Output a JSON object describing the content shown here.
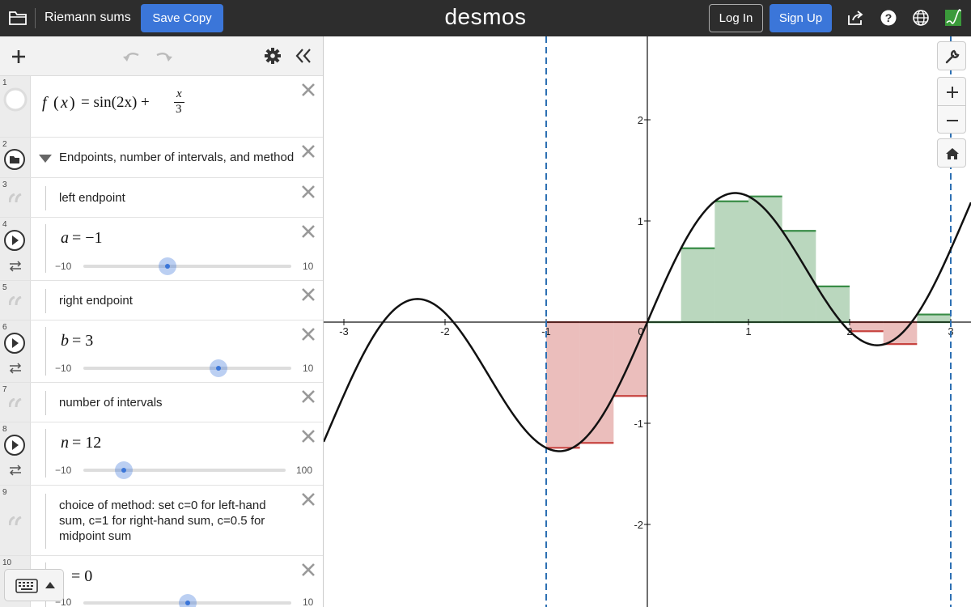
{
  "header": {
    "title": "Riemann sums",
    "save_copy": "Save Copy",
    "logo": "desmos",
    "login": "Log In",
    "signup": "Sign Up",
    "icons": [
      "folder-icon",
      "share-icon",
      "help-icon",
      "globe-icon",
      "account-icon"
    ]
  },
  "toolbar": {
    "icons": [
      "add-icon",
      "undo-icon",
      "redo-icon",
      "gear-icon",
      "collapse-icon"
    ]
  },
  "expressions": {
    "e1": {
      "index": "1",
      "fname": "f",
      "xvar": "x",
      "eq": "= sin(2x) +",
      "num": "x",
      "den": "3"
    },
    "e2": {
      "index": "2",
      "label": "Endpoints, number of intervals, and method"
    },
    "e3": {
      "index": "3",
      "label": "left endpoint"
    },
    "e4": {
      "index": "4",
      "var": "a",
      "value": "= −1",
      "min": "−10",
      "max": "10"
    },
    "e5": {
      "index": "5",
      "label": "right endpoint"
    },
    "e6": {
      "index": "6",
      "var": "b",
      "value": "= 3",
      "min": "−10",
      "max": "10"
    },
    "e7": {
      "index": "7",
      "label": "number of intervals"
    },
    "e8": {
      "index": "8",
      "var": "n",
      "value": "= 12",
      "min": "−10",
      "max": "100"
    },
    "e9": {
      "index": "9",
      "label": "choice of method: set c=0 for left-hand sum, c=1 for right-hand sum, c=0.5 for midpoint sum"
    },
    "e10": {
      "index": "10",
      "value": "= 0",
      "min": "−10",
      "max": "10"
    }
  },
  "sliders": {
    "a": {
      "min": -10,
      "max": 10,
      "value": -1
    },
    "b": {
      "min": -10,
      "max": 10,
      "value": 3
    },
    "n": {
      "min": -10,
      "max": 100,
      "value": 12
    },
    "c": {
      "min": -10,
      "max": 10,
      "value": 0
    }
  },
  "graph": {
    "x_ticks": [
      "-3",
      "-2",
      "-1",
      "0",
      "1",
      "2",
      "3"
    ],
    "y_ticks": [
      "2",
      "1",
      "-1",
      "-2"
    ],
    "controls": [
      "wrench-icon",
      "zoom-in-icon",
      "zoom-out-icon",
      "home-icon"
    ],
    "colors": {
      "curve": "#111111",
      "positive": "#388c46",
      "negative": "#c74440",
      "bounds": "#2d70b3"
    }
  },
  "chart_data": {
    "type": "area",
    "function": "f(x) = sin(2x) + x/3",
    "a": -1,
    "b": 3,
    "n": 12,
    "c": 0,
    "xlim": [
      -3.2,
      3.2
    ],
    "ylim": [
      -2.8,
      2.9
    ],
    "rectangles": [
      {
        "x0": -1.0,
        "x1": -0.6667,
        "height": -1.2426
      },
      {
        "x0": -0.6667,
        "x1": -0.3333,
        "height": -1.194
      },
      {
        "x0": -0.3333,
        "x1": 0.0,
        "height": -0.7298
      },
      {
        "x0": 0.0,
        "x1": 0.3333,
        "height": 0.0
      },
      {
        "x0": 0.3333,
        "x1": 0.6667,
        "height": 0.7298
      },
      {
        "x0": 0.6667,
        "x1": 1.0,
        "height": 1.194
      },
      {
        "x0": 1.0,
        "x1": 1.3333,
        "height": 1.2426
      },
      {
        "x0": 1.3333,
        "x1": 1.6667,
        "height": 0.902
      },
      {
        "x0": 1.6667,
        "x1": 2.0,
        "height": 0.3529
      },
      {
        "x0": 2.0,
        "x1": 2.3333,
        "height": -0.0901
      },
      {
        "x0": 2.3333,
        "x1": 2.6667,
        "height": -0.2172
      },
      {
        "x0": 2.6667,
        "x1": 3.0,
        "height": 0.0755
      }
    ]
  }
}
